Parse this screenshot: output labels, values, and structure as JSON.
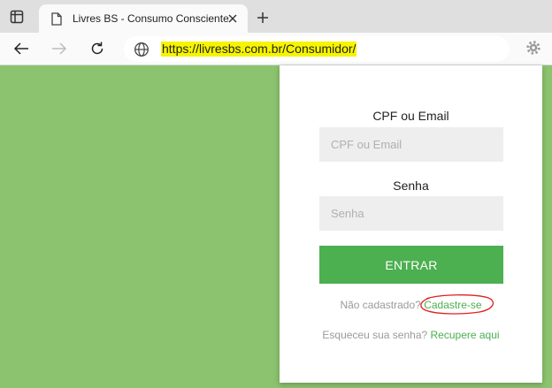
{
  "browser": {
    "tab": {
      "title": "Livres BS - Consumo Consciente"
    },
    "address": {
      "url": "https://livresbs.com.br/Consumidor/"
    }
  },
  "login": {
    "login_label": "CPF ou Email",
    "login_placeholder": "CPF ou Email",
    "password_label": "Senha",
    "password_placeholder": "Senha",
    "submit_label": "ENTRAR",
    "register_prompt": "Não cadastrado?",
    "register_link": "Cadastre-se",
    "forgot_prompt": "Esqueceu sua senha?",
    "forgot_link": "Recupere aqui"
  },
  "colors": {
    "page_background": "#8cc36e",
    "button": "#4caf50",
    "link": "#4caf50",
    "annotation_circle": "#e02020",
    "url_highlight": "#f7f400"
  },
  "icons": [
    "tab-actions-icon",
    "page-icon",
    "close-icon",
    "plus-icon",
    "back-arrow-icon",
    "forward-arrow-icon",
    "reload-icon",
    "globe-icon",
    "gear-icon"
  ]
}
